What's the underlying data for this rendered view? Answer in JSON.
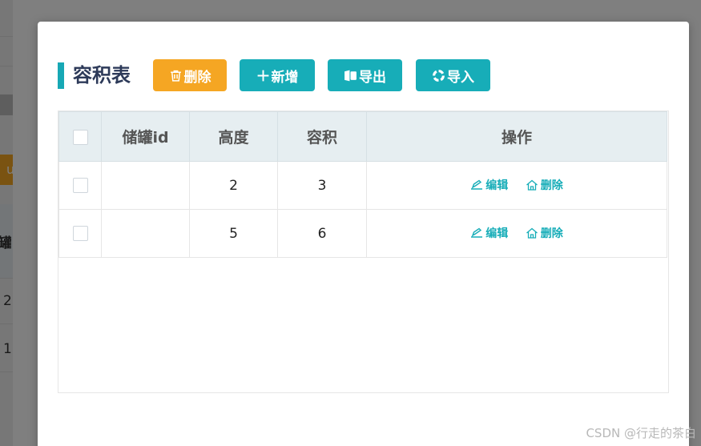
{
  "background": {
    "button_fragment": "u",
    "header_fragment": "罐组",
    "row1_fragment": "2",
    "row2_fragment": "1"
  },
  "dialog": {
    "title": "容积表",
    "buttons": {
      "delete": {
        "label": "删除",
        "icon": "trash-icon"
      },
      "add": {
        "label": "新增",
        "icon": "plus-icon"
      },
      "export": {
        "label": "导出",
        "icon": "export-icon"
      },
      "import": {
        "label": "导入",
        "icon": "import-icon"
      }
    },
    "table": {
      "columns": [
        "储罐id",
        "高度",
        "容积",
        "操作"
      ],
      "rows": [
        {
          "tank_id": "",
          "height": "2",
          "volume": "3"
        },
        {
          "tank_id": "",
          "height": "5",
          "volume": "6"
        }
      ],
      "actions": {
        "edit": "编辑",
        "delete": "删除"
      }
    }
  },
  "watermark": "CSDN @行走的茶白",
  "colors": {
    "accent": "#17adb8",
    "warning": "#f5a623",
    "title": "#2d3a59",
    "header_bg": "#e6eef1"
  }
}
